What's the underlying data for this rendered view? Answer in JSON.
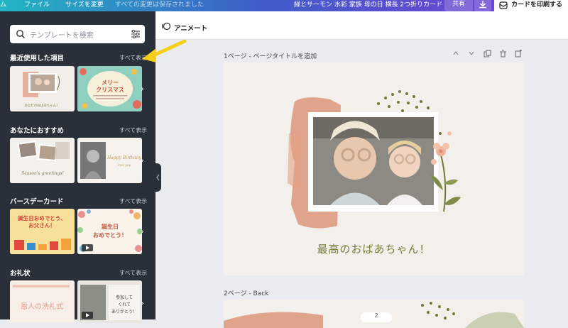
{
  "topbar": {
    "home_fragment": "ム",
    "file_menu": "ファイル",
    "resize_menu": "サイズを変更",
    "save_status": "すべての変更は保存されました",
    "document_title": "緑とサーモン 水彩 家族 母の日 横長 2つ折りカード",
    "share_label": "共有",
    "print_label": "カードを印刷する"
  },
  "sidebar": {
    "search_placeholder": "テンプレートを検索",
    "sections": [
      {
        "title": "最近使用した項目",
        "link": "すべて表示"
      },
      {
        "title": "あなたにおすすめ",
        "link": "すべて表示"
      },
      {
        "title": "バースデーカード",
        "link": "すべて表示"
      },
      {
        "title": "お礼状",
        "link": "すべて表示"
      }
    ],
    "thumb_texts": {
      "recent_1": "あなたのおばあちゃん！",
      "recent_2": "メリー\nクリスマス",
      "rec_1": "Season's greetings!",
      "rec_2": "Happy Birthday",
      "bday_1": "誕生日おめでとう、\nお父さん！",
      "bday_2": "誕生日\nおめでとう！",
      "thanks_1": "恩人の洗礼式",
      "thanks_2": "参加して\nくれて\nありがとう！"
    }
  },
  "canvas": {
    "animate_label": "アニメート",
    "page1_label": "1ページ - ページタイトルを追加",
    "page2_label": "2ページ - Back",
    "card_message": "最高のおばあちゃん！",
    "pager_label": "2"
  },
  "colors": {
    "sidebar_bg": "#293039",
    "accent_gradient_start": "#22b5c3",
    "accent_gradient_end": "#7b3fd6",
    "card_bg": "#f3f0ec",
    "watercolor": "#d98b6e",
    "dots": "#6e7a3b"
  }
}
